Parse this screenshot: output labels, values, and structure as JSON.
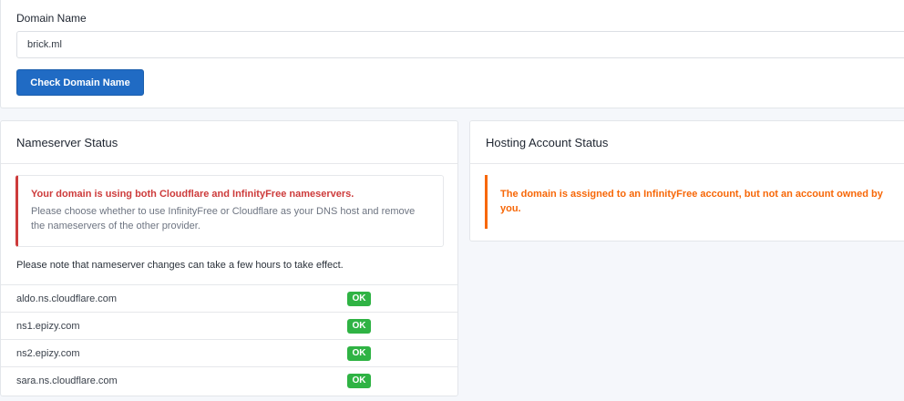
{
  "domain_form": {
    "label": "Domain Name",
    "value": "brick.ml",
    "button_label": "Check Domain Name"
  },
  "nameserver_status": {
    "title": "Nameserver Status",
    "alert_title": "Your domain is using both Cloudflare and InfinityFree nameservers.",
    "alert_body": "Please choose whether to use InfinityFree or Cloudflare as your DNS host and remove the nameservers of the other provider.",
    "note": "Please note that nameserver changes can take a few hours to take effect.",
    "rows": [
      {
        "name": "aldo.ns.cloudflare.com",
        "status": "OK"
      },
      {
        "name": "ns1.epizy.com",
        "status": "OK"
      },
      {
        "name": "ns2.epizy.com",
        "status": "OK"
      },
      {
        "name": "sara.ns.cloudflare.com",
        "status": "OK"
      }
    ]
  },
  "hosting_status": {
    "title": "Hosting Account Status",
    "message": "The domain is assigned to an InfinityFree account, but not an account owned by you."
  },
  "colors": {
    "primary": "#206bc4",
    "danger": "#cd3b3b",
    "warning": "#f76707",
    "success": "#2fb344"
  }
}
